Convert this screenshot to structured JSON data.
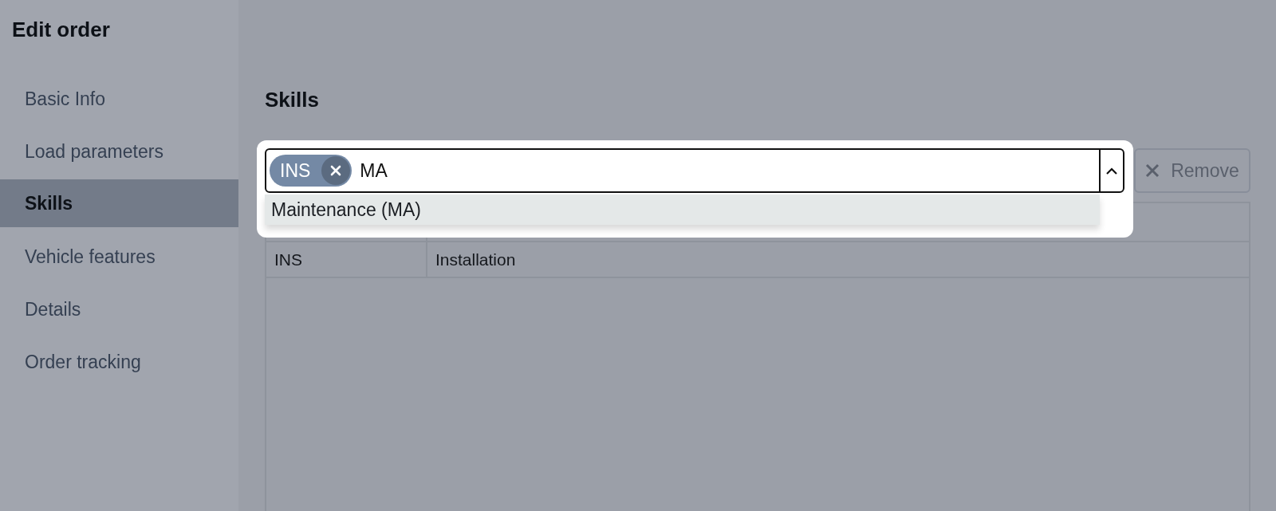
{
  "dialog": {
    "title": "Edit order"
  },
  "sidebar": {
    "items": [
      {
        "label": "Basic Info",
        "selected": false
      },
      {
        "label": "Load parameters",
        "selected": false
      },
      {
        "label": "Skills",
        "selected": true
      },
      {
        "label": "Vehicle features",
        "selected": false
      },
      {
        "label": "Details",
        "selected": false
      },
      {
        "label": "Order tracking",
        "selected": false
      }
    ]
  },
  "section": {
    "title": "Skills"
  },
  "skill_select": {
    "chips": [
      {
        "label": "INS"
      }
    ],
    "value": "MA",
    "expanded": true,
    "options": [
      {
        "label": "Maintenance (MA)",
        "highlighted": true
      }
    ]
  },
  "remove_button": {
    "label": "Remove",
    "disabled": true
  },
  "table": {
    "rows": [
      {
        "code": "INS",
        "name": "Installation"
      }
    ]
  }
}
